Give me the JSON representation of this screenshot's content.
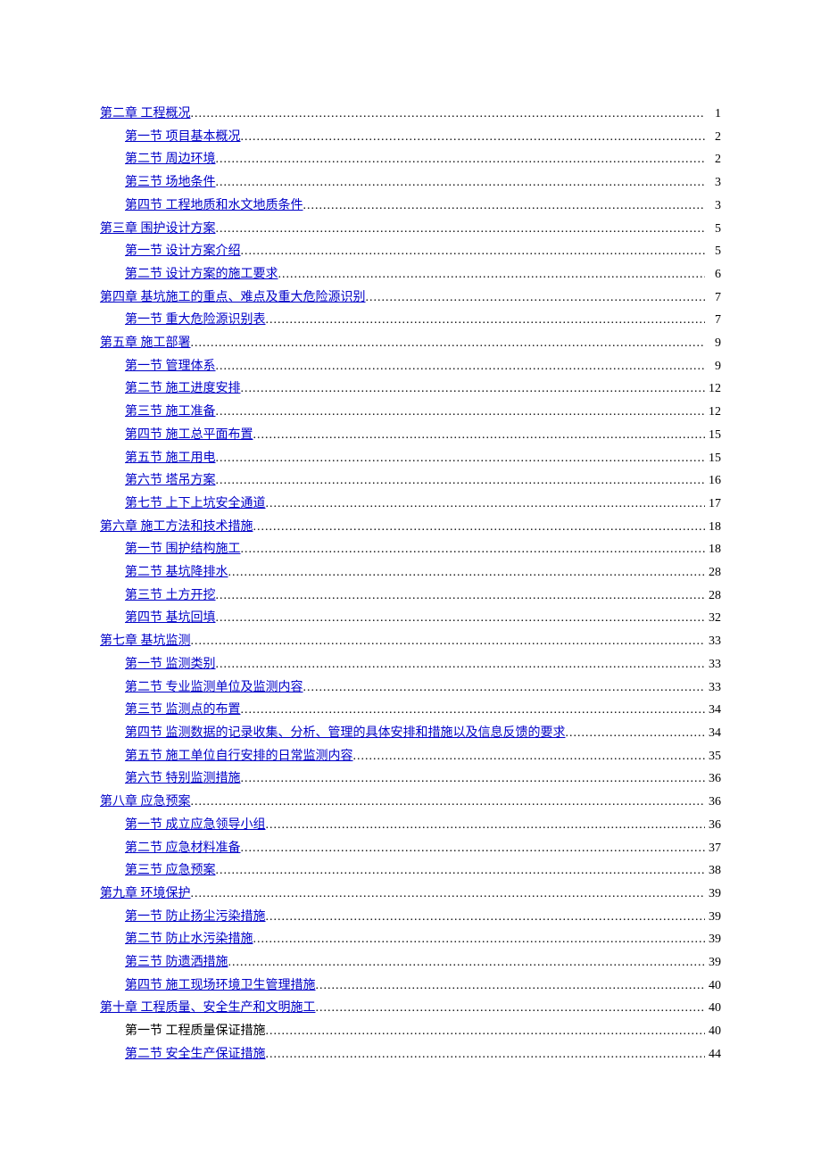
{
  "toc": [
    {
      "label": "第二章 工程概况",
      "page": "1",
      "level": 0
    },
    {
      "label": "第一节 项目基本概况",
      "page": "2",
      "level": 1
    },
    {
      "label": "第二节 周边环境",
      "page": "2",
      "level": 1
    },
    {
      "label": "第三节 场地条件",
      "page": "3",
      "level": 1
    },
    {
      "label": "第四节 工程地质和水文地质条件",
      "page": "3",
      "level": 1
    },
    {
      "label": "第三章 围护设计方案",
      "page": "5",
      "level": 0
    },
    {
      "label": "第一节 设计方案介绍",
      "page": "5",
      "level": 1
    },
    {
      "label": "第二节 设计方案的施工要求",
      "page": "6",
      "level": 1
    },
    {
      "label": "第四章 基坑施工的重点、难点及重大危险源识别",
      "page": "7",
      "level": 0
    },
    {
      "label": "第一节 重大危险源识别表",
      "page": "7",
      "level": 1
    },
    {
      "label": "第五章 施工部署",
      "page": "9",
      "level": 0
    },
    {
      "label": "第一节 管理体系",
      "page": "9",
      "level": 1
    },
    {
      "label": "第二节 施工进度安排",
      "page": "12",
      "level": 1
    },
    {
      "label": "第三节 施工准备",
      "page": "12",
      "level": 1
    },
    {
      "label": "第四节 施工总平面布置",
      "page": "15",
      "level": 1
    },
    {
      "label": "第五节 施工用电",
      "page": "15",
      "level": 1
    },
    {
      "label": "第六节 塔吊方案",
      "page": "16",
      "level": 1
    },
    {
      "label": "第七节 上下上坑安全通道",
      "page": "17",
      "level": 1
    },
    {
      "label": "第六章 施工方法和技术措施",
      "page": "18",
      "level": 0
    },
    {
      "label": "第一节 围护结构施工",
      "page": "18",
      "level": 1
    },
    {
      "label": "第二节 基坑降排水",
      "page": "28",
      "level": 1
    },
    {
      "label": "第三节 土方开挖",
      "page": "28",
      "level": 1
    },
    {
      "label": "第四节 基坑回填",
      "page": "32",
      "level": 1
    },
    {
      "label": "第七章 基坑监测",
      "page": "33",
      "level": 0
    },
    {
      "label": "第一节 监测类别",
      "page": "33",
      "level": 1
    },
    {
      "label": "第二节 专业监测单位及监测内容",
      "page": "33",
      "level": 1
    },
    {
      "label": "第三节 监测点的布置",
      "page": "34",
      "level": 1
    },
    {
      "label": "第四节 监测数据的记录收集、分析、管理的具体安排和措施以及信息反馈的要求",
      "page": "34",
      "level": 1
    },
    {
      "label": "第五节 施工单位自行安排的日常监测内容",
      "page": "35",
      "level": 1
    },
    {
      "label": "第六节 特别监测措施",
      "page": "36",
      "level": 1
    },
    {
      "label": "第八章 应急预案",
      "page": "36",
      "level": 0
    },
    {
      "label": "第一节 成立应急领导小组",
      "page": "36",
      "level": 1
    },
    {
      "label": "第二节 应急材料准备",
      "page": "37",
      "level": 1
    },
    {
      "label": "第三节 应急预案",
      "page": "38",
      "level": 1
    },
    {
      "label": "第九章 环境保护",
      "page": "39",
      "level": 0
    },
    {
      "label": "第一节 防止扬尘污染措施",
      "page": "39",
      "level": 1
    },
    {
      "label": "第二节 防止水污染措施",
      "page": "39",
      "level": 1
    },
    {
      "label": "第三节 防遗洒措施",
      "page": "39",
      "level": 1
    },
    {
      "label": "第四节 施工现场环境卫生管理措施",
      "page": "40",
      "level": 1
    },
    {
      "label": "第十章 工程质量、安全生产和文明施工",
      "page": "40",
      "level": 0
    },
    {
      "label": "第一节 工程质量保证措施",
      "page": "40",
      "level": 1,
      "plain": true
    },
    {
      "label": "第二节 安全生产保证措施",
      "page": "44",
      "level": 1
    }
  ]
}
